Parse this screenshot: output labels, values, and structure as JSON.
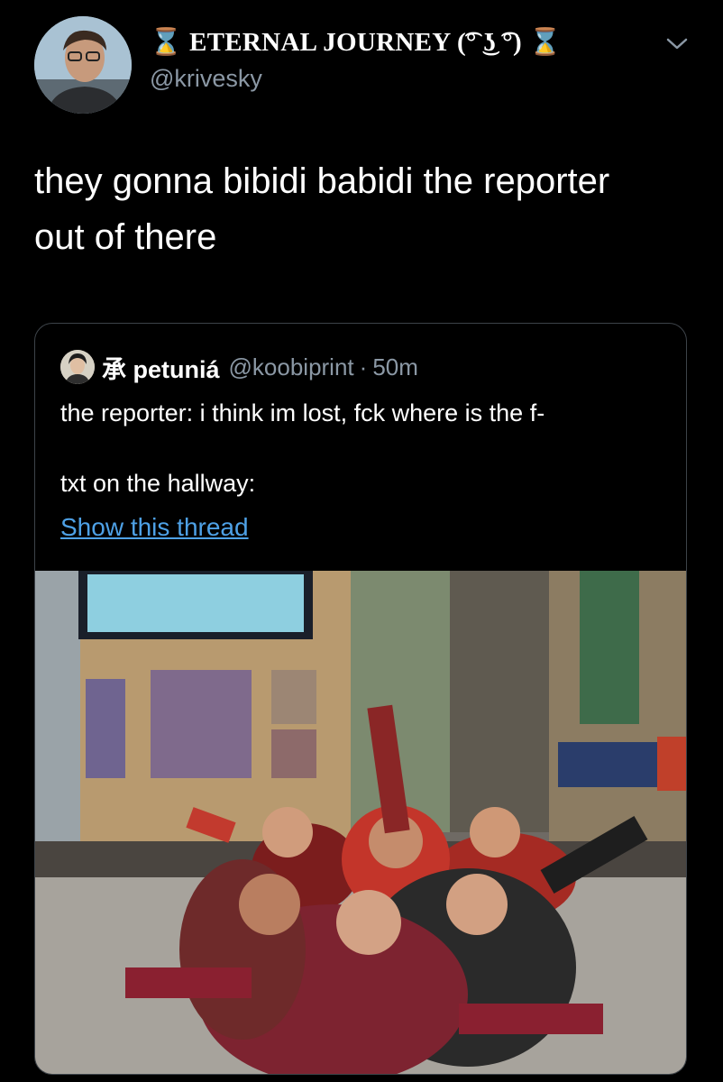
{
  "author": {
    "display_name": "⌛ ETERNAL JOURNEY (͡° ͜ʖ ͡°) ⌛",
    "handle": "@krivesky"
  },
  "tweet": {
    "text_line1": "they gonna bibidi babidi the reporter",
    "text_line2": "out of there"
  },
  "quoted": {
    "display_name": "承 petuniá",
    "handle": "@koobiprint",
    "separator": "·",
    "time": "50m",
    "text_line1": "the reporter: i think im lost, fck where is the f-",
    "text_line2": "txt on the hallway:",
    "link_label": "Show this thread"
  },
  "icons": {
    "menu": "chevron-down-icon"
  },
  "colors": {
    "background": "#000000",
    "secondary_text": "#8b98a5",
    "link": "#4ea1e6",
    "card_border": "#3d4349"
  }
}
